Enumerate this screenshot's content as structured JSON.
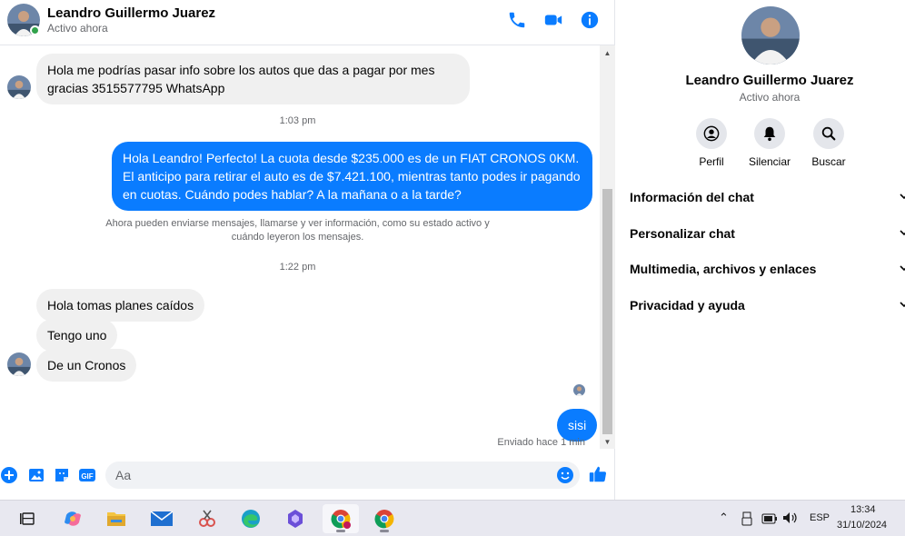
{
  "header": {
    "contact_name": "Leandro Guillermo Juarez",
    "status": "Activo ahora",
    "icons": [
      "phone-icon",
      "video-icon",
      "info-icon"
    ]
  },
  "messages": {
    "incoming_1": "Hola me podrías pasar info sobre los autos que das a pagar por mes gracias 3515577795 WhatsApp",
    "time_1": "1:03 pm",
    "outgoing_1": "Hola Leandro! Perfecto! La cuota desde $235.000 es de un FIAT CRONOS 0KM. El anticipo para retirar el auto es de $7.421.100, mientras tanto podes ir pagando en cuotas. Cuándo podes hablar? A la mañana o a la tarde?",
    "system_note": "Ahora pueden enviarse mensajes, llamarse y ver información, como su estado activo y cuándo leyeron los mensajes.",
    "time_2": "1:22 pm",
    "incoming_2": "Hola tomas planes caídos",
    "incoming_3": "Tengo uno",
    "incoming_4": "De un Cronos",
    "outgoing_2": "sisi",
    "sent_status": "Enviado hace 1 min"
  },
  "composer": {
    "placeholder": "Aa",
    "icons": [
      "plus-icon",
      "image-icon",
      "sticker-icon",
      "gif-icon",
      "emoji-icon",
      "like-icon"
    ]
  },
  "info_panel": {
    "name": "Leandro Guillermo Juarez",
    "status": "Activo ahora",
    "actions": [
      "Perfil",
      "Silenciar",
      "Buscar"
    ],
    "sections": [
      "Información del chat",
      "Personalizar chat",
      "Multimedia, archivos y enlaces",
      "Privacidad y ayuda"
    ]
  },
  "taskbar": {
    "apps": [
      "task-view",
      "copilot",
      "file-explorer",
      "mail",
      "snipping-tool",
      "edge",
      "app-purple",
      "chrome-profile",
      "chrome"
    ],
    "language": "ESP",
    "time": "13:34",
    "date": "31/10/2024"
  },
  "colors": {
    "accent": "#0a7cff",
    "incoming_bubble": "#f0f0f0",
    "online": "#31a24c"
  }
}
